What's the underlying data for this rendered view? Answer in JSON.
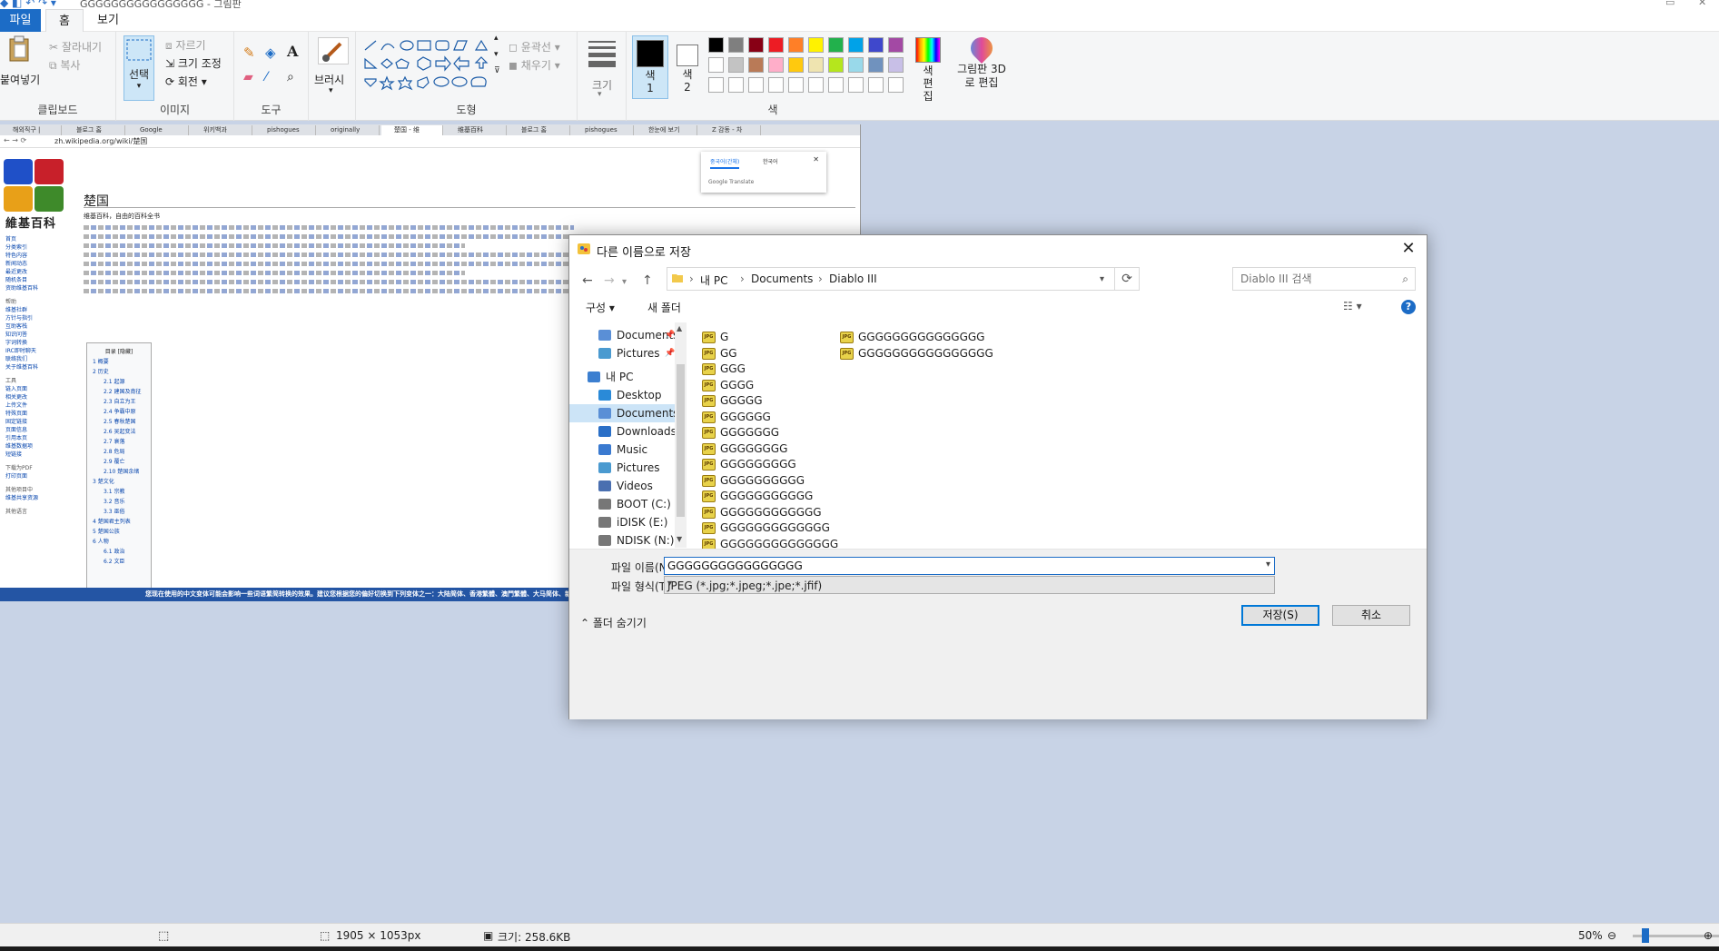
{
  "window": {
    "title": "GGGGGGGGGGGGGGGG - 그림판"
  },
  "menu": {
    "file": "파일",
    "home": "홈",
    "view": "보기"
  },
  "ribbon": {
    "clipboard": {
      "label": "클립보드",
      "paste": "붙여넣기",
      "cut": "잘라내기",
      "copy": "복사"
    },
    "image": {
      "label": "이미지",
      "select": "선택",
      "crop": "자르기",
      "resize": "크기 조정",
      "rotate": "회전"
    },
    "tools": {
      "label": "도구"
    },
    "brushes": {
      "label": "브러시"
    },
    "shapes": {
      "label": "도형",
      "outline": "윤곽선",
      "fill": "채우기"
    },
    "size": {
      "label": "크기"
    },
    "colors": {
      "label": "색",
      "color1": "색 1",
      "color2": "색 2",
      "edit_colors": "색 편집",
      "paint3d": "그림판 3D로 편집",
      "color1_value": "#000000",
      "color2_value": "#ffffff",
      "palette_row1": [
        "#000000",
        "#7f7f7f",
        "#880015",
        "#ed1c24",
        "#ff7f27",
        "#fff200",
        "#22b14c",
        "#00a2e8",
        "#3f48cc",
        "#a349a4"
      ],
      "palette_row2": [
        "#ffffff",
        "#c3c3c3",
        "#b97a57",
        "#ffaec9",
        "#ffc90e",
        "#efe4b0",
        "#b5e61d",
        "#99d9ea",
        "#7092be",
        "#c8bfe7"
      ]
    }
  },
  "browser": {
    "url": "zh.wikipedia.org/wiki/楚国",
    "tabs": [
      "해외직구 |",
      "블로그 홈",
      "Google",
      "위키백과",
      "pishogues",
      "originally",
      "楚国 - 维",
      "维基百科",
      "블로그 홈",
      "pishogues",
      "한눈에 보기",
      "Z 감동 - 차"
    ],
    "wiki_name": "維基百科",
    "article_title": "楚国",
    "tagline": "维基百科，自由的百科全书",
    "translate_langs": [
      "중국어(간체)",
      "한국어"
    ],
    "translate_brand": "Google Translate",
    "notice": "您现在使用的中文变体可能会影响一些词语繁简转换的效果。建议您根据您的偏好切换到下列变体之一：大陆简体、香港繁體、澳門繁體、大马简体、新加坡简体、臺灣正體。",
    "toc_title": "目录 [隐藏]",
    "toc": [
      "1 概要",
      "2 历史",
      "2.1 起源",
      "2.2 建国及南征",
      "2.3 自立为王",
      "2.4 争霸中原",
      "2.5 春秋楚国",
      "2.6 吴起变法",
      "2.7 衰落",
      "2.8 危局",
      "2.9 覆亡",
      "2.10 楚国余绪",
      "3 楚文化",
      "3.1 宗教",
      "3.2 音乐",
      "3.3 巫俗",
      "4 楚国君主列表",
      "5 楚国公族",
      "6 人物",
      "6.1 政治",
      "6.2 文臣"
    ],
    "sidebar": [
      "首页",
      "分类索引",
      "特色内容",
      "新闻动态",
      "最近更改",
      "随机条目",
      "资助维基百科",
      "帮助",
      "维基社群",
      "方针与指引",
      "互助客栈",
      "知识问答",
      "字词转换",
      "IRC即时聊天",
      "联络我们",
      "关于维基百科",
      "工具",
      "链入页面",
      "相关更改",
      "上传文件",
      "特殊页面",
      "固定链接",
      "页面信息",
      "引用本页",
      "维基数据项",
      "短链接",
      "下载为PDF",
      "打印页面",
      "其他项目中",
      "维基共享资源",
      "其他语言"
    ]
  },
  "dialog": {
    "title": "다른 이름으로 저장",
    "breadcrumb": [
      "내 PC",
      "Documents",
      "Diablo III"
    ],
    "search_placeholder": "Diablo III 검색",
    "organize": "구성",
    "new_folder": "새 폴더",
    "nav": [
      {
        "label": "Documents",
        "icon": "documents-icon",
        "pinned": true
      },
      {
        "label": "Pictures",
        "icon": "pictures-icon",
        "pinned": true
      },
      {
        "label": "내 PC",
        "icon": "pc-icon",
        "pinned": false
      },
      {
        "label": "Desktop",
        "icon": "desktop-icon",
        "pinned": false
      },
      {
        "label": "Documents",
        "icon": "documents-icon",
        "pinned": false,
        "selected": true
      },
      {
        "label": "Downloads",
        "icon": "downloads-icon",
        "pinned": false
      },
      {
        "label": "Music",
        "icon": "music-icon",
        "pinned": false
      },
      {
        "label": "Pictures",
        "icon": "pictures-icon",
        "pinned": false
      },
      {
        "label": "Videos",
        "icon": "videos-icon",
        "pinned": false
      },
      {
        "label": "BOOT (C:)",
        "icon": "drive-icon",
        "pinned": false
      },
      {
        "label": "iDISK (E:)",
        "icon": "drive-icon",
        "pinned": false
      },
      {
        "label": "NDISK (N:)",
        "icon": "drive-icon",
        "pinned": false
      }
    ],
    "files_col1": [
      "G",
      "GG",
      "GGG",
      "GGGG",
      "GGGGG",
      "GGGGGG",
      "GGGGGGG",
      "GGGGGGGG",
      "GGGGGGGGG",
      "GGGGGGGGGG",
      "GGGGGGGGGGG",
      "GGGGGGGGGGGG",
      "GGGGGGGGGGGGG",
      "GGGGGGGGGGGGGG"
    ],
    "files_col2": [
      "GGGGGGGGGGGGGGG",
      "GGGGGGGGGGGGGGGG"
    ],
    "file_icon_text": "JPG",
    "filename_label": "파일 이름(N):",
    "filename_value": "GGGGGGGGGGGGGGGG",
    "filetype_label": "파일 형식(T):",
    "filetype_value": "JPEG (*.jpg;*.jpeg;*.jpe;*.jfif)",
    "hide_folders": "폴더 숨기기",
    "save": "저장(S)",
    "cancel": "취소"
  },
  "status": {
    "dimensions": "1905 × 1053px",
    "size": "크기: 258.6KB",
    "zoom": "50%"
  }
}
